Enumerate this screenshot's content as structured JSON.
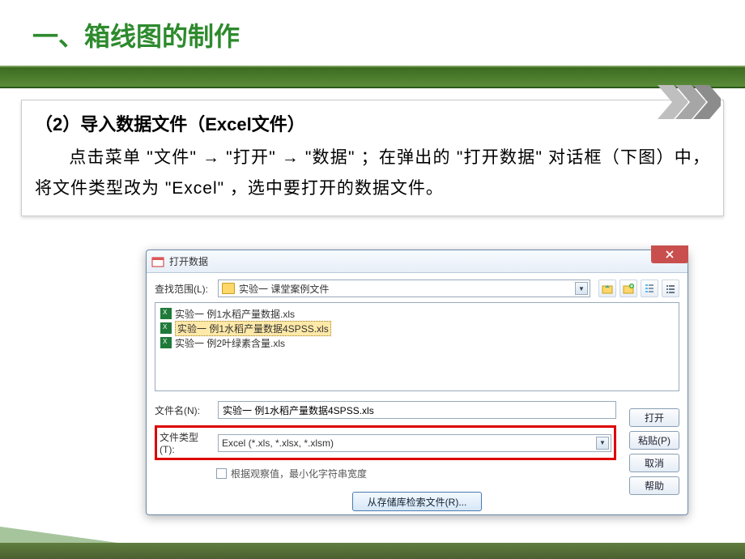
{
  "slide": {
    "title": "一、箱线图的制作",
    "heading": "（2）导入数据文件（Excel文件）",
    "paragraph": "点击菜单 \"文件\" → \"打开\" → \"数据\" ；在弹出的 \"打开数据\" 对话框（下图）中，将文件类型改为 \"Excel\" ，选中要打开的数据文件。"
  },
  "dialog": {
    "title": "打开数据",
    "lookin_label": "查找范围(L):",
    "lookin_value": "实验一 课堂案例文件",
    "files": [
      "实验一 例1水稻产量数据.xls",
      "实验一 例1水稻产量数据4SPSS.xls",
      "实验一 例2叶绿素含量.xls"
    ],
    "filename_label": "文件名(N):",
    "filename_value": "实验一 例1水稻产量数据4SPSS.xls",
    "filetype_label": "文件类型(T):",
    "filetype_value": "Excel (*.xls, *.xlsx, *.xlsm)",
    "minimize_check": "根据观察值，最小化字符串宽度",
    "btn_open": "打开",
    "btn_paste": "粘贴(P)",
    "btn_cancel": "取消",
    "btn_help": "帮助",
    "btn_repo": "从存储库检索文件(R)..."
  }
}
